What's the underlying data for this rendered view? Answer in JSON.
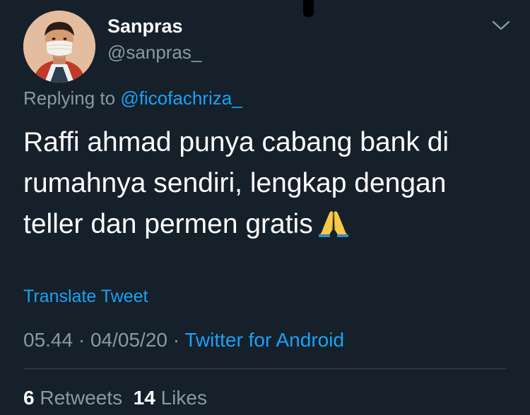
{
  "tweet": {
    "author": {
      "display_name": "Sanpras",
      "handle": "@sanpras_",
      "avatar": "avatar-masked-person"
    },
    "menu_icon": "chevron-down-icon",
    "replying_label": "Replying to",
    "replying_to": "@ficofachriza_",
    "text_lines": [
      "Raffi ahmad punya cabang bank di",
      "rumahnya sendiri, lengkap dengan",
      "teller dan permen gratis"
    ],
    "emoji": "folded-hands-emoji",
    "translate_label": "Translate Tweet",
    "time": "05.44",
    "date": "04/05/20",
    "separator": "·",
    "source": "Twitter for Android",
    "retweets_count": "6",
    "retweets_label": "Retweets",
    "likes_count": "14",
    "likes_label": "Likes"
  },
  "colors": {
    "background": "#15202b",
    "primary_text": "#ffffff",
    "secondary_text": "#8899a6",
    "accent": "#1da1f2",
    "divider": "#38444d"
  }
}
